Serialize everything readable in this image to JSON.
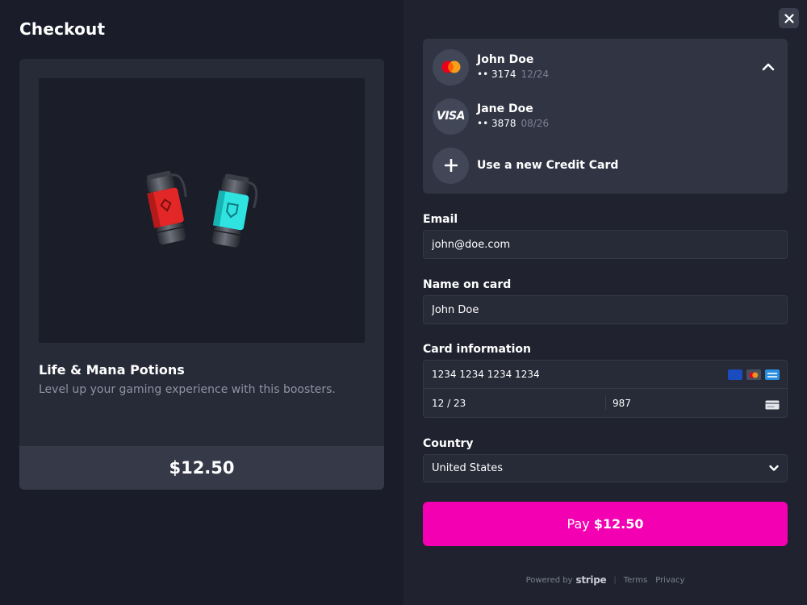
{
  "header": {
    "title": "Checkout"
  },
  "product": {
    "name": "Life & Mana Potions",
    "description": "Level up your gaming experience with this boosters.",
    "price": "$12.50"
  },
  "saved_cards": [
    {
      "name": "John Doe",
      "brand": "mastercard",
      "masked": "•• 3174",
      "exp": "12/24",
      "selected": true
    },
    {
      "name": "Jane Doe",
      "brand": "visa",
      "brand_text": "VISA",
      "masked": "•• 3878",
      "exp": "08/26",
      "selected": false
    }
  ],
  "new_card": {
    "label": "Use a new Credit Card"
  },
  "form": {
    "email": {
      "label": "Email",
      "value": "john@doe.com"
    },
    "name_on_card": {
      "label": "Name on card",
      "value": "John Doe"
    },
    "card_info": {
      "label": "Card information",
      "number": "1234 1234 1234 1234",
      "expiry": "12 / 23",
      "cvc": "987"
    },
    "country": {
      "label": "Country",
      "value": "United States"
    }
  },
  "pay_button": {
    "prefix": "Pay",
    "amount": "$12.50"
  },
  "footer": {
    "powered_by": "Powered by",
    "brand": "stripe",
    "separator": "|",
    "terms": "Terms",
    "privacy": "Privacy"
  },
  "colors": {
    "accent": "#f200b2",
    "background": "#1a1d29",
    "panel": "#20232f"
  }
}
